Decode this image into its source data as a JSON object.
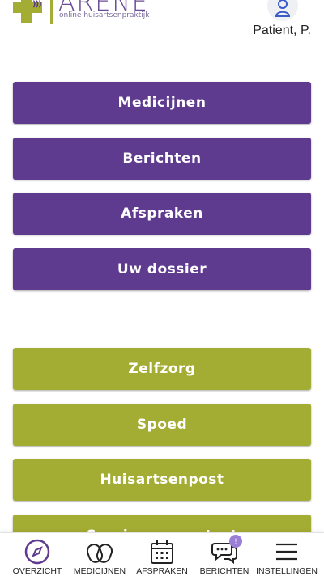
{
  "header": {
    "logo_name": "ARENE",
    "logo_subtitle": "online huisartsenpraktijk",
    "user_name": "Patient, P."
  },
  "menu": {
    "primary": [
      "Medicijnen",
      "Berichten",
      "Afspraken",
      "Uw dossier"
    ],
    "secondary": [
      "Zelfzorg",
      "Spoed",
      "Huisartsenpost",
      "Service en contact"
    ]
  },
  "bottom_nav": {
    "items": [
      "OVERZICHT",
      "MEDICIJNEN",
      "AFSPRAKEN",
      "BERICHTEN",
      "INSTELLINGEN"
    ],
    "messages_badge": "!"
  },
  "colors": {
    "purple": "#5e3b8f",
    "green": "#a4ad33"
  }
}
